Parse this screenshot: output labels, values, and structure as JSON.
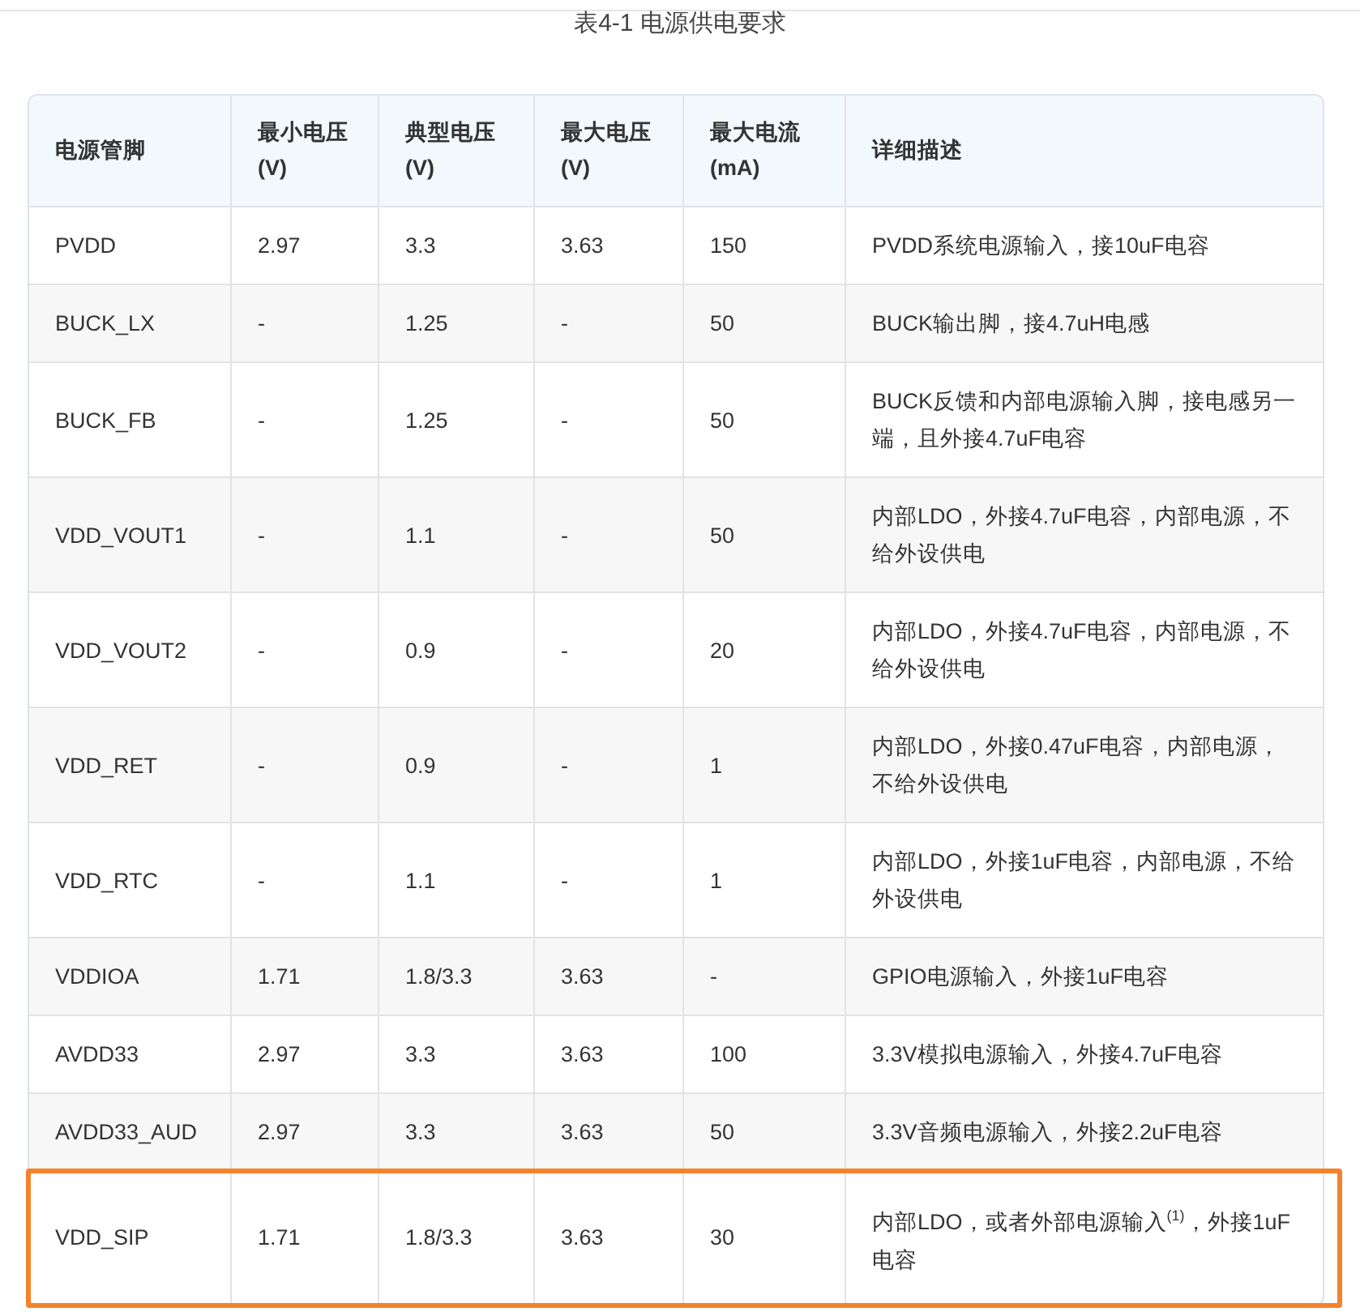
{
  "caption": "表4-1 电源供电要求",
  "table": {
    "columns": [
      "电源管脚",
      "最小电压\n(V)",
      "典型电压\n(V)",
      "最大电压\n(V)",
      "最大电流\n(mA)",
      "详细描述"
    ],
    "rows": [
      {
        "cells": [
          "PVDD",
          "2.97",
          "3.3",
          "3.63",
          "150",
          "PVDD系统电源输入，接10uF电容"
        ],
        "highlighted": false
      },
      {
        "cells": [
          "BUCK_LX",
          "-",
          "1.25",
          "-",
          "50",
          "BUCK输出脚，接4.7uH电感"
        ],
        "highlighted": false
      },
      {
        "cells": [
          "BUCK_FB",
          "-",
          "1.25",
          "-",
          "50",
          "BUCK反馈和内部电源输入脚，接电感另一端，且外接4.7uF电容"
        ],
        "highlighted": false
      },
      {
        "cells": [
          "VDD_VOUT1",
          "-",
          "1.1",
          "-",
          "50",
          "内部LDO，外接4.7uF电容，内部电源，不给外设供电"
        ],
        "highlighted": false
      },
      {
        "cells": [
          "VDD_VOUT2",
          "-",
          "0.9",
          "-",
          "20",
          "内部LDO，外接4.7uF电容，内部电源，不给外设供电"
        ],
        "highlighted": false
      },
      {
        "cells": [
          "VDD_RET",
          "-",
          "0.9",
          "-",
          "1",
          "内部LDO，外接0.47uF电容，内部电源，不给外设供电"
        ],
        "highlighted": false
      },
      {
        "cells": [
          "VDD_RTC",
          "-",
          "1.1",
          "-",
          "1",
          "内部LDO，外接1uF电容，内部电源，不给外设供电"
        ],
        "highlighted": false
      },
      {
        "cells": [
          "VDDIOA",
          "1.71",
          "1.8/3.3",
          "3.63",
          "-",
          "GPIO电源输入，外接1uF电容"
        ],
        "highlighted": false
      },
      {
        "cells": [
          "AVDD33",
          "2.97",
          "3.3",
          "3.63",
          "100",
          "3.3V模拟电源输入，外接4.7uF电容"
        ],
        "highlighted": false
      },
      {
        "cells": [
          "AVDD33_AUD",
          "2.97",
          "3.3",
          "3.63",
          "50",
          "3.3V音频电源输入，外接2.2uF电容"
        ],
        "highlighted": false
      },
      {
        "cells": [
          "VDD_SIP",
          "1.71",
          "1.8/3.3",
          "3.63",
          "30",
          "内部LDO，或者外部电源输入$^{(1)}$，外接1uF电容"
        ],
        "highlighted": true
      }
    ]
  }
}
